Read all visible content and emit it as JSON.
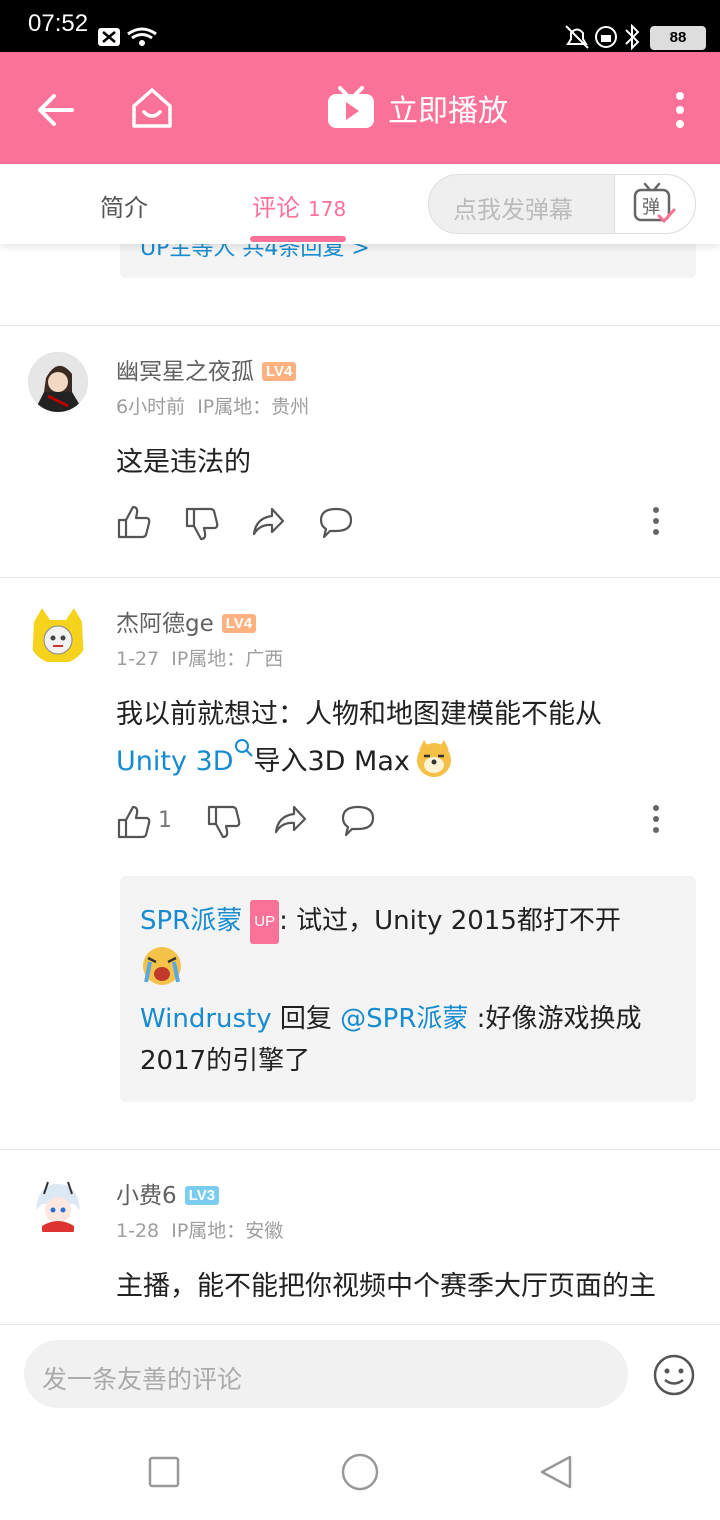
{
  "status_bar": {
    "time": "07:52",
    "battery": "88"
  },
  "app_bar": {
    "title": "立即播放"
  },
  "tabs": {
    "intro": "简介",
    "comments": "评论",
    "comments_count": "178",
    "danmaku_placeholder": "点我发弹幕",
    "danmaku_btn": "弹"
  },
  "partial_reply": {
    "text_visible": "UP主等人 共4条回复 >"
  },
  "comments": [
    {
      "username": "幽冥星之夜孤",
      "level": "LV4",
      "time": "6小时前",
      "ip": "IP属地：贵州",
      "text": "这是违法的"
    },
    {
      "username": "杰阿德ge",
      "level": "LV4",
      "time": "1-27",
      "ip": "IP属地：广西",
      "text_line1": "我以前就想过：人物和地图建模能不能从",
      "link": "Unity 3D",
      "text_after_link": "导入3D Max",
      "like_count": "1",
      "replies": {
        "r1_user": "SPR派蒙",
        "r1_badge": "UP",
        "r1_text": ": 试过，Unity 2015都打不开",
        "r2_user": "Windrusty",
        "r2_mid": " 回复 ",
        "r2_at": "@SPR派蒙",
        "r2_text": " :好像游戏换成",
        "r2_text2": "2017的引擎了"
      }
    },
    {
      "username": "小费6",
      "level": "LV3",
      "time": "1-28",
      "ip": "IP属地：安徽",
      "text": "主播，能不能把你视频中个赛季大厅页面的主"
    }
  ],
  "bottom": {
    "placeholder": "发一条友善的评论"
  },
  "colors": {
    "brand": "#fb7299",
    "link": "#178bcf",
    "lv4": "#ffb27f",
    "lv3": "#7bcdef"
  }
}
